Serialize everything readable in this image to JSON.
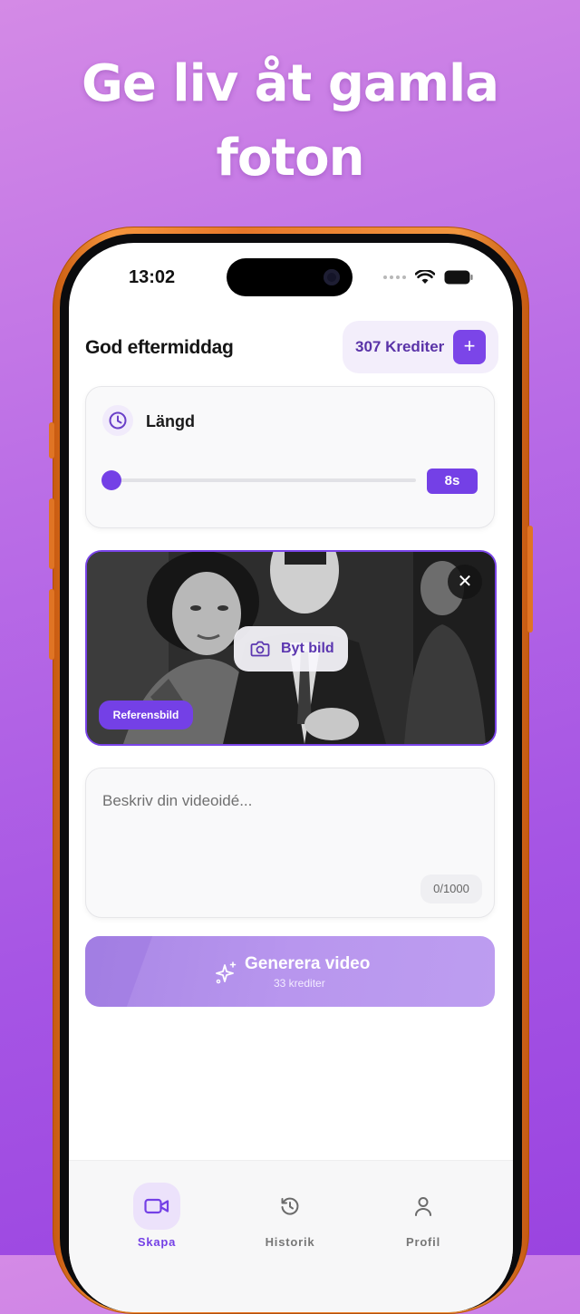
{
  "headline": {
    "line1": "Ge liv åt gamla",
    "line2": "foton"
  },
  "status_bar": {
    "time": "13:02"
  },
  "header": {
    "greeting": "God eftermiddag",
    "credits_label": "307 Krediter",
    "add_credits_icon": "plus-icon"
  },
  "length": {
    "icon": "clock-icon",
    "label": "Längd",
    "value_label": "8s",
    "slider_fraction": 0.0
  },
  "photo": {
    "close_icon": "close-icon",
    "swap_label": "Byt bild",
    "swap_icon": "camera-icon",
    "reference_badge": "Referensbild"
  },
  "prompt": {
    "placeholder": "Beskriv din videoidé...",
    "value": "",
    "char_count": "0/1000"
  },
  "generate": {
    "icon": "sparkles-icon",
    "label": "Generera video",
    "cost": "33 krediter"
  },
  "tabs": [
    {
      "label": "Skapa",
      "icon": "video-camera-icon",
      "active": true
    },
    {
      "label": "Historik",
      "icon": "history-icon",
      "active": false
    },
    {
      "label": "Profil",
      "icon": "user-icon",
      "active": false
    }
  ],
  "colors": {
    "accent": "#7440e6",
    "background_top": "#d48ae6",
    "background_bottom": "#9a44e0",
    "phone_frame": "#f0893a"
  }
}
